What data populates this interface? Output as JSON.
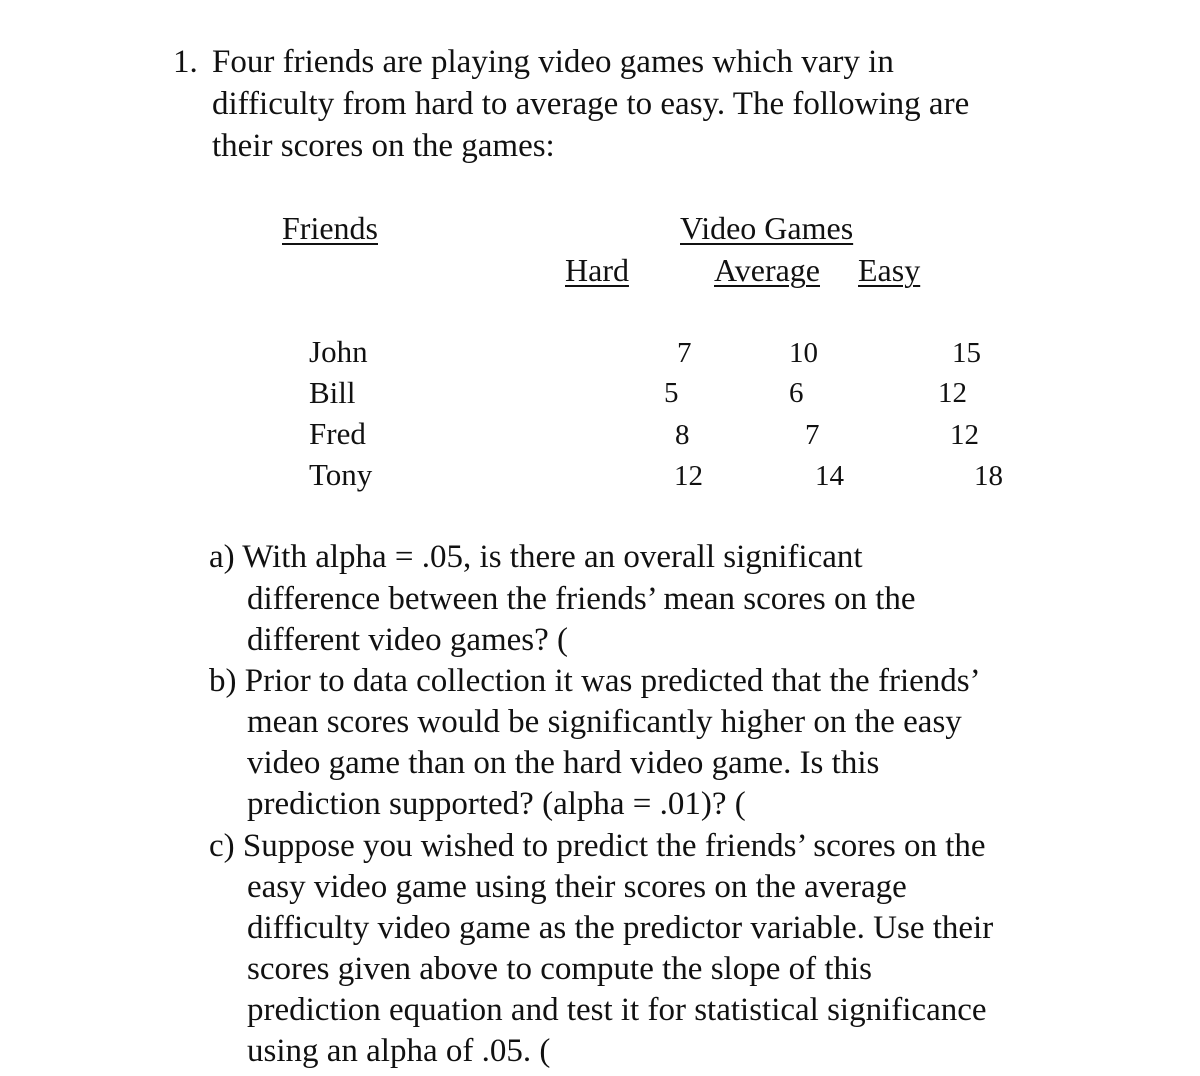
{
  "problem": {
    "number": "1.",
    "intro_lines": [
      "Four friends are playing video games which vary in",
      "difficulty from hard to average to easy. The following are",
      "their scores on the games:"
    ]
  },
  "table": {
    "row_header": "Friends",
    "group_header": "Video Games",
    "columns": [
      "Hard",
      "Average",
      "Easy"
    ],
    "rows": [
      {
        "name": "John",
        "values": [
          "7",
          "10",
          "15"
        ]
      },
      {
        "name": "Bill",
        "values": [
          "5",
          "6",
          "12"
        ]
      },
      {
        "name": "Fred",
        "values": [
          "8",
          "7",
          "12"
        ]
      },
      {
        "name": "Tony",
        "values": [
          "12",
          "14",
          "18"
        ]
      }
    ]
  },
  "questions": {
    "a": {
      "lines": [
        "a) With alpha = .05, is there an overall significant",
        "difference between the friends’ mean scores on the",
        "different video games? ("
      ]
    },
    "b": {
      "lines": [
        "b) Prior to data collection it was predicted that the friends’",
        "mean scores would be significantly higher on the easy",
        "video game than on the hard video game. Is this",
        "prediction supported? (alpha = .01)? ("
      ]
    },
    "c": {
      "lines": [
        "c) Suppose you wished to predict the friends’ scores on the",
        "easy video game using their scores on the average",
        "difficulty video game as the predictor variable. Use their",
        "scores given above to compute the slope of this",
        "prediction equation and test it for statistical significance",
        "using an alpha of .05. ("
      ]
    }
  }
}
